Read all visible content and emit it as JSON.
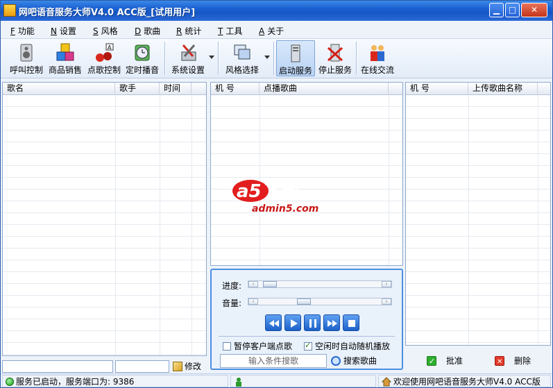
{
  "window": {
    "title": "网吧语音服务大师V4.0 ACC版_[试用用户]",
    "min_glyph": "▁",
    "max_glyph": "□",
    "close_glyph": "✕"
  },
  "menu": [
    {
      "key": "F",
      "label": "功能"
    },
    {
      "key": "N",
      "label": "设置"
    },
    {
      "key": "S",
      "label": "风格"
    },
    {
      "key": "D",
      "label": "歌曲"
    },
    {
      "key": "R",
      "label": "统计"
    },
    {
      "key": "T",
      "label": "工具"
    },
    {
      "key": "A",
      "label": "关于"
    }
  ],
  "toolbar": {
    "call": "呼叫控制",
    "sales": "商品销售",
    "song_ctrl": "点歌控制",
    "timer": "定时播音",
    "settings": "系统设置",
    "style": "风格选择",
    "start": "启动服务",
    "stop": "停止服务",
    "online": "在线交流"
  },
  "left_grid": {
    "headers": [
      "歌名",
      "歌手",
      "时间"
    ]
  },
  "middle_grid": {
    "headers": [
      "机 号",
      "点播歌曲"
    ]
  },
  "right_grid": {
    "headers": [
      "机 号",
      "上传歌曲名称"
    ]
  },
  "player": {
    "progress_label": "进度:",
    "volume_label": "音量:",
    "progress": 0.03,
    "volume": 0.35,
    "pause_client_label": "暂停客户端点歌",
    "pause_client_checked": false,
    "auto_random_label": "空闲时自动随机播放",
    "auto_random_checked": true
  },
  "search": {
    "placeholder": "输入条件搜歌",
    "button": "搜索歌曲"
  },
  "left_footer": {
    "modify": "修改"
  },
  "right_footer": {
    "approve": "批准",
    "delete": "删除"
  },
  "watermark": {
    "brand": "a5下载",
    "site": "admin5.com"
  },
  "status": {
    "service": "服务已启动，服务端口为: 9386",
    "welcome": "欢迎使用网吧语音服务大师V4.0 ACC版"
  },
  "colors": {
    "titlebar": "#1a5fd0",
    "accent": "#4e8fe0",
    "ok": "#2fae2f",
    "danger": "#e43a2a"
  }
}
